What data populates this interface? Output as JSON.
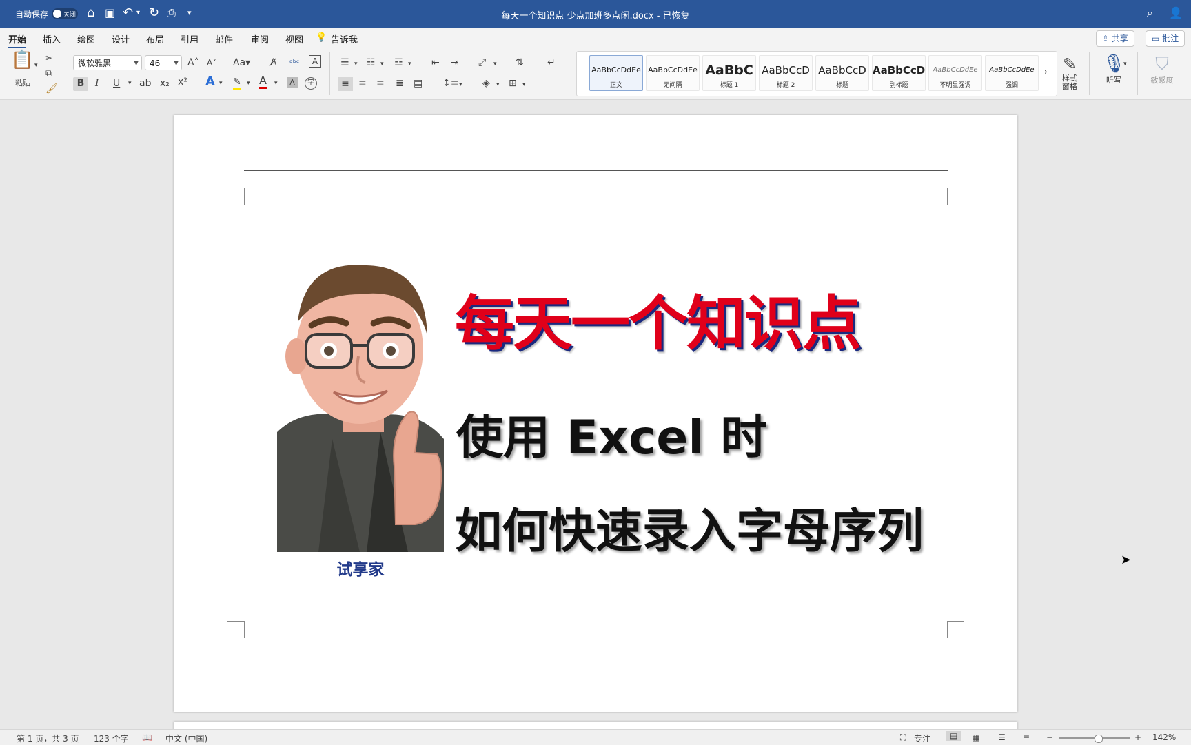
{
  "titlebar": {
    "autosave_label": "自动保存",
    "autosave_state": "关闭",
    "doc_title": "每天一个知识点 少点加班多点闲.docx - 已恢复",
    "accent": "#2b579a"
  },
  "tabs": [
    "开始",
    "插入",
    "绘图",
    "设计",
    "布局",
    "引用",
    "邮件",
    "审阅",
    "视图"
  ],
  "tell_me": "告诉我",
  "share_label": "共享",
  "comment_label": "批注",
  "ribbon": {
    "paste_label": "粘贴",
    "font_name": "微软雅黑",
    "font_size": "46",
    "styles": [
      {
        "preview": "AaBbCcDdEe",
        "name": "正文"
      },
      {
        "preview": "AaBbCcDdEe",
        "name": "无间隔"
      },
      {
        "preview": "AaBbC",
        "name": "标题 1"
      },
      {
        "preview": "AaBbCcD",
        "name": "标题 2"
      },
      {
        "preview": "AaBbCcD",
        "name": "标题"
      },
      {
        "preview": "AaBbCcD",
        "name": "副标题"
      },
      {
        "preview": "AaBbCcDdEe",
        "name": "不明显强调"
      },
      {
        "preview": "AaBbCcDdEe",
        "name": "强调"
      }
    ],
    "styles_pane_label": "样式窗格",
    "dictate_label": "听写",
    "sensitivity_label": "敏感度"
  },
  "document": {
    "heading": "每天一个知识点",
    "line2": "使用 Excel 时",
    "line3": "如何快速录入字母序列",
    "caption": "试享家",
    "heading_color": "#e0001a"
  },
  "status": {
    "page_info": "第 1 页，共 3 页",
    "word_count": "123 个字",
    "language": "中文 (中国)",
    "focus_label": "专注",
    "zoom": "142%"
  }
}
